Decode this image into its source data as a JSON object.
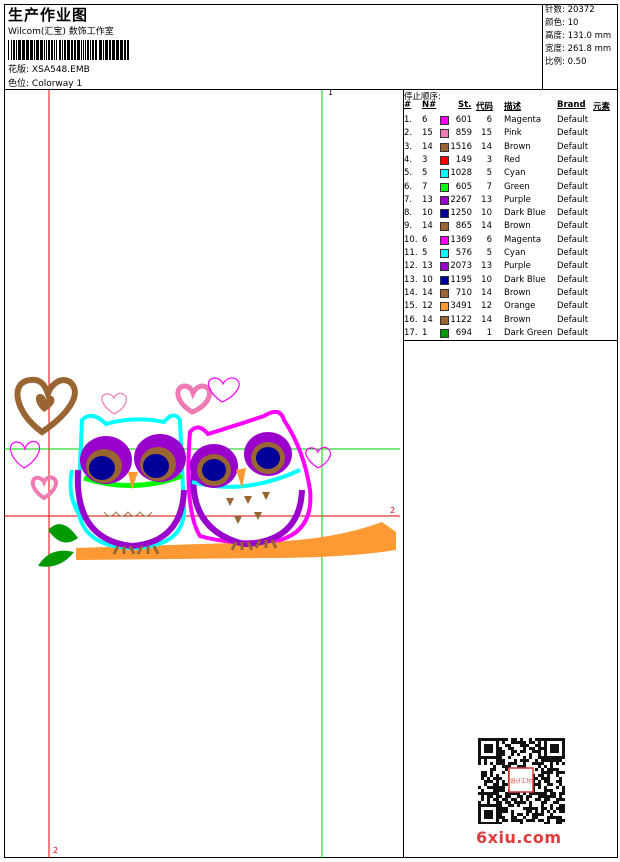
{
  "header": {
    "title": "生产作业图",
    "company": "Wilcom(汇宝) 数饰工作室",
    "design_label": "花版: ",
    "design_value": "XSA548.EMB",
    "colorway_label": "色位: ",
    "colorway_value": "Colorway 1"
  },
  "stats": {
    "stitches": "针数: 20372",
    "colors": "颜色: 10",
    "height": "高度: 131.0 mm",
    "width": "宽度: 261.8 mm",
    "scale": "比例: 0.50"
  },
  "guides": {
    "label_top": "1",
    "label_right": "2",
    "label_bottom": "2"
  },
  "sequence": {
    "title": "停止顺序:",
    "headers": {
      "hash": "#",
      "needle": "N#",
      "stitches": "St.",
      "code": "代码",
      "desc": "描述",
      "brand": "Brand",
      "element": "元素"
    },
    "rows": [
      {
        "n": "1.",
        "needle": "6",
        "st": "601",
        "code": "6",
        "desc": "Magenta",
        "brand": "Default",
        "color": "#ff00ff"
      },
      {
        "n": "2.",
        "needle": "15",
        "st": "859",
        "code": "15",
        "desc": "Pink",
        "brand": "Default",
        "color": "#f07ab4"
      },
      {
        "n": "3.",
        "needle": "14",
        "st": "1516",
        "code": "14",
        "desc": "Brown",
        "brand": "Default",
        "color": "#996633"
      },
      {
        "n": "4.",
        "needle": "3",
        "st": "149",
        "code": "3",
        "desc": "Red",
        "brand": "Default",
        "color": "#ff0000"
      },
      {
        "n": "5.",
        "needle": "5",
        "st": "1028",
        "code": "5",
        "desc": "Cyan",
        "brand": "Default",
        "color": "#00ffff"
      },
      {
        "n": "6.",
        "needle": "7",
        "st": "605",
        "code": "7",
        "desc": "Green",
        "brand": "Default",
        "color": "#00ff00"
      },
      {
        "n": "7.",
        "needle": "13",
        "st": "2267",
        "code": "13",
        "desc": "Purple",
        "brand": "Default",
        "color": "#9900cc"
      },
      {
        "n": "8.",
        "needle": "10",
        "st": "1250",
        "code": "10",
        "desc": "Dark Blue",
        "brand": "Default",
        "color": "#000099"
      },
      {
        "n": "9.",
        "needle": "14",
        "st": "865",
        "code": "14",
        "desc": "Brown",
        "brand": "Default",
        "color": "#996633"
      },
      {
        "n": "10.",
        "needle": "6",
        "st": "1369",
        "code": "6",
        "desc": "Magenta",
        "brand": "Default",
        "color": "#ff00ff"
      },
      {
        "n": "11.",
        "needle": "5",
        "st": "576",
        "code": "5",
        "desc": "Cyan",
        "brand": "Default",
        "color": "#00ffff"
      },
      {
        "n": "12.",
        "needle": "13",
        "st": "2073",
        "code": "13",
        "desc": "Purple",
        "brand": "Default",
        "color": "#9900cc"
      },
      {
        "n": "13.",
        "needle": "10",
        "st": "1195",
        "code": "10",
        "desc": "Dark Blue",
        "brand": "Default",
        "color": "#000099"
      },
      {
        "n": "14.",
        "needle": "14",
        "st": "710",
        "code": "14",
        "desc": "Brown",
        "brand": "Default",
        "color": "#996633"
      },
      {
        "n": "15.",
        "needle": "12",
        "st": "3491",
        "code": "12",
        "desc": "Orange",
        "brand": "Default",
        "color": "#ff9933"
      },
      {
        "n": "16.",
        "needle": "14",
        "st": "1122",
        "code": "14",
        "desc": "Brown",
        "brand": "Default",
        "color": "#996633"
      },
      {
        "n": "17.",
        "needle": "1",
        "st": "694",
        "code": "1",
        "desc": "Dark Green",
        "brand": "Default",
        "color": "#009900"
      }
    ]
  },
  "watermark": "6xiu.com",
  "qr_seal_text": "设计工坊"
}
